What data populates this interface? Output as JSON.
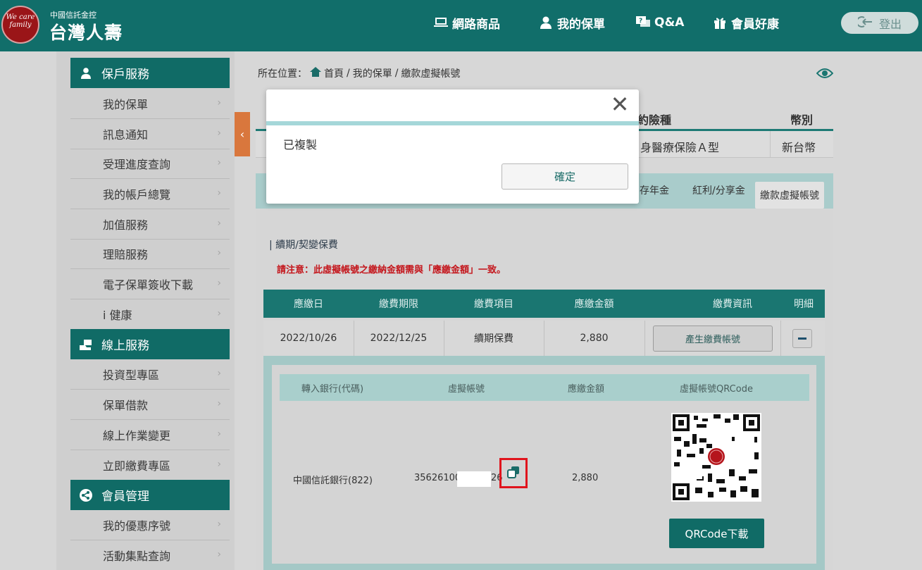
{
  "header": {
    "logo_text": "We care family",
    "brand_sub": "中國信託金控",
    "brand_main": "台灣人壽",
    "nav": [
      {
        "label": "網路商品",
        "icon": "laptop-24h-icon"
      },
      {
        "label": "我的保單",
        "icon": "person-icon"
      },
      {
        "label": "Q&A",
        "icon": "question-bubble-icon"
      },
      {
        "label": "會員好康",
        "icon": "gift-icon"
      }
    ],
    "logout_label": "登出"
  },
  "sidebar": {
    "groups": [
      {
        "title": "保戶服務",
        "icon": "person-icon",
        "items": [
          "我的保單",
          "訊息通知",
          "受理進度查詢",
          "我的帳戶總覽",
          "加值服務",
          "理賠服務",
          "電子保單簽收下載",
          "i 健康"
        ]
      },
      {
        "title": "線上服務",
        "icon": "card-hand-icon",
        "items": [
          "投資型專區",
          "保單借款",
          "線上作業變更",
          "立即繳費專區"
        ]
      },
      {
        "title": "會員管理",
        "icon": "share-icon",
        "items": [
          "我的優惠序號",
          "活動集點查詢"
        ]
      }
    ]
  },
  "breadcrumb": {
    "prefix": "所在位置：",
    "home": "首頁",
    "sep": "/",
    "level2": "我的保單",
    "level3": "繳款虛擬帳號"
  },
  "policy_table": {
    "header_partial_type": "約險種",
    "header_currency": "幣別",
    "row_partial_type": "身醫療保險Ａ型",
    "row_currency": "新台幣"
  },
  "tabs": {
    "items": [
      "存年金",
      "紅利/分享金"
    ],
    "active": "繳款虛擬帳號"
  },
  "section": {
    "title": "續期/契變保費",
    "notice": "請注意：此虛擬帳號之繳納金額需與「應繳金額」一致。"
  },
  "pay_table": {
    "headers": [
      "應繳日",
      "繳費期限",
      "繳費項目",
      "應繳金額",
      "繳費資訊",
      "明細"
    ],
    "row": {
      "due_date": "2022/10/26",
      "deadline": "2022/12/25",
      "item": "續期保費",
      "amount": "2,880"
    },
    "generate_button": "產生繳費帳號"
  },
  "detail_table": {
    "headers": [
      "轉入銀行(代碼)",
      "虛擬帳號",
      "應繳金額",
      "虛擬帳號QRCode"
    ],
    "bank": "中國信託銀行(822)",
    "account_prefix": "35626100",
    "account_suffix": "26",
    "amount": "2,880",
    "qr_download": "QRCode下載"
  },
  "modal": {
    "message": "已複製",
    "ok_label": "確定",
    "close_glyph": "✕"
  }
}
